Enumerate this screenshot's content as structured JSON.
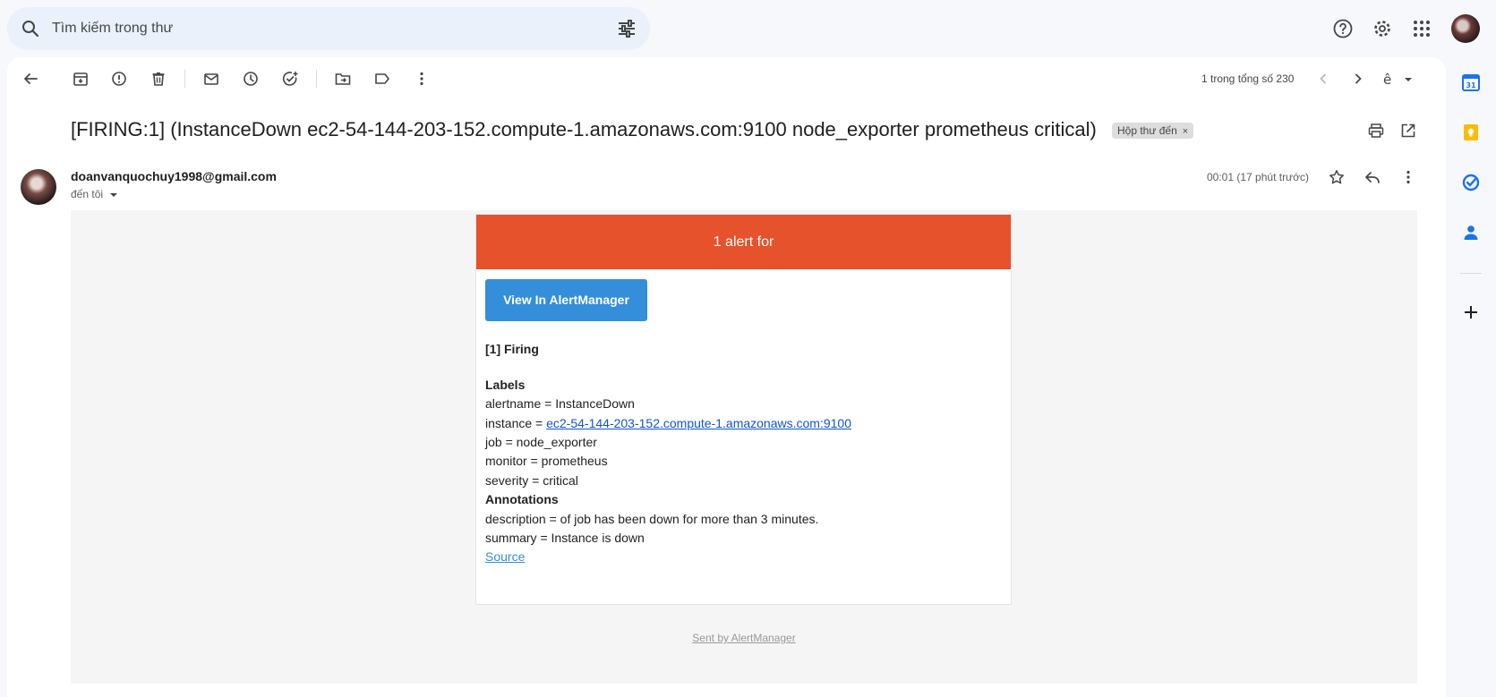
{
  "search": {
    "placeholder": "Tìm kiếm trong thư"
  },
  "pager": {
    "text": "1 trong tổng số 230"
  },
  "email": {
    "subject": "[FIRING:1] (InstanceDown ec2-54-144-203-152.compute-1.amazonaws.com:9100 node_exporter prometheus critical)",
    "label": "Hộp thư đến",
    "label_close": "×",
    "sender": "doanvanquochuy1998@gmail.com",
    "recipient": "đến tôi",
    "time": "00:01 (17 phút trước)"
  },
  "alert": {
    "header": "1 alert for",
    "button": "View In AlertManager",
    "firing": "[1] Firing",
    "labels_title": "Labels",
    "alertname": "alertname = InstanceDown",
    "instance_prefix": "instance = ",
    "instance_link": "ec2-54-144-203-152.compute-1.amazonaws.com:9100",
    "job": "job = node_exporter",
    "monitor": "monitor = prometheus",
    "severity": "severity = critical",
    "annotations_title": "Annotations",
    "description": "description = of job has been down for more than 3 minutes.",
    "summary": "summary = Instance is down",
    "source": "Source",
    "sent_by": "Sent by AlertManager"
  },
  "colors": {
    "alert_header": "#e6522c",
    "button": "#348eda",
    "panel_bg": "#f6f8fc",
    "search_bg": "#eaf1fb"
  },
  "icons": [
    "search-icon",
    "filter-icon",
    "help-icon",
    "settings-icon",
    "apps-icon",
    "back-icon",
    "archive-icon",
    "spam-icon",
    "delete-icon",
    "mark-unread-icon",
    "snooze-icon",
    "add-task-icon",
    "move-to-icon",
    "label-icon",
    "more-icon",
    "prev-icon",
    "next-icon",
    "input-tools-icon",
    "print-icon",
    "open-new-window-icon",
    "star-icon",
    "reply-icon",
    "calendar-icon",
    "keep-icon",
    "tasks-icon",
    "contacts-icon",
    "add-icon"
  ]
}
